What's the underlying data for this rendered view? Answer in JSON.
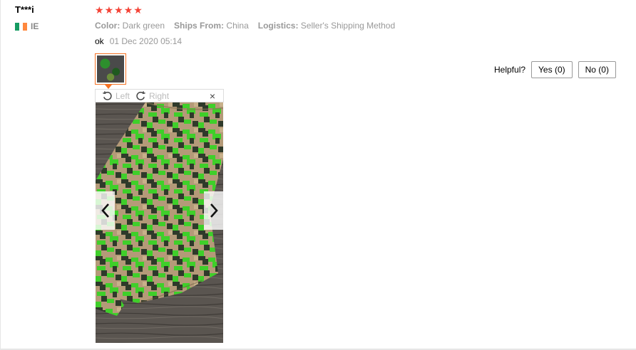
{
  "review": {
    "user": "T***i",
    "country_code": "IE",
    "flag_colors": [
      "#169b62",
      "#ffffff",
      "#ff883e"
    ],
    "rating": 5,
    "star_char": "★",
    "attributes": [
      {
        "key": "Color:",
        "value": "Dark green"
      },
      {
        "key": "Ships From:",
        "value": "China"
      },
      {
        "key": "Logistics:",
        "value": "Seller's Shipping Method"
      }
    ],
    "text": "ok",
    "date": "01 Dec 2020 05:14"
  },
  "helpful": {
    "label": "Helpful?",
    "yes": "Yes (0)",
    "no": "No (0)"
  },
  "viewer": {
    "rotate_left": "Left",
    "rotate_right": "Right",
    "close": "×",
    "accent": "#f57224"
  }
}
